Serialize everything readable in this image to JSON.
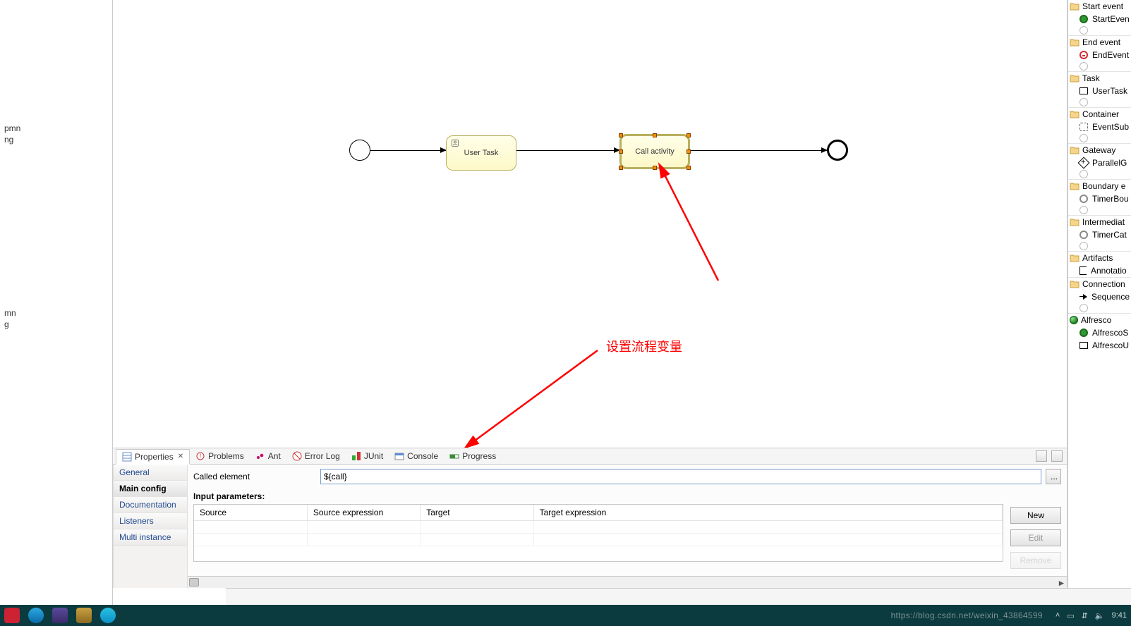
{
  "left_files": [
    {
      "name_top": "pmn",
      "name_bottom": "ng"
    },
    {
      "name_top": "mn",
      "name_bottom": "g"
    }
  ],
  "diagram": {
    "user_task_label": "User Task",
    "call_activity_label": "Call activity"
  },
  "annotation": {
    "text": "设置流程变量"
  },
  "tabs": [
    {
      "label": "Properties",
      "active": true,
      "closable": true
    },
    {
      "label": "Problems"
    },
    {
      "label": "Ant"
    },
    {
      "label": "Error Log"
    },
    {
      "label": "JUnit"
    },
    {
      "label": "Console"
    },
    {
      "label": "Progress"
    }
  ],
  "prop_sidebar": [
    {
      "label": "General"
    },
    {
      "label": "Main config",
      "active": true
    },
    {
      "label": "Documentation"
    },
    {
      "label": "Listeners"
    },
    {
      "label": "Multi instance"
    }
  ],
  "properties": {
    "called_element_label": "Called element",
    "called_element_value": "${call}",
    "ellipsis": "...",
    "input_params_label": "Input parameters:",
    "columns": {
      "source": "Source",
      "source_expr": "Source expression",
      "target": "Target",
      "target_expr": "Target expression"
    },
    "buttons": {
      "new": "New",
      "edit": "Edit",
      "remove": "Remove"
    }
  },
  "palette": {
    "categories": [
      {
        "label": "Start event",
        "items": [
          {
            "label": "StartEven",
            "icon": "green-fill"
          }
        ],
        "dim_below": true
      },
      {
        "label": "End event",
        "items": [
          {
            "label": "EndEvent",
            "icon": "red-ring"
          }
        ],
        "dim_below": true
      },
      {
        "label": "Task",
        "items": [
          {
            "label": "UserTask",
            "icon": "rect-box"
          }
        ],
        "dim_below": true
      },
      {
        "label": "Container",
        "items": [
          {
            "label": "EventSub",
            "icon": "dashed-box"
          }
        ],
        "dim_below": true
      },
      {
        "label": "Gateway",
        "items": [
          {
            "label": "ParallelG",
            "icon": "diamond plus"
          }
        ],
        "dim_below": true
      },
      {
        "label": "Boundary e",
        "items": [
          {
            "label": "TimerBou",
            "icon": "grey-ring"
          }
        ],
        "dim_below": true
      },
      {
        "label": "Intermediat",
        "items": [
          {
            "label": "TimerCat",
            "icon": "grey-ring"
          }
        ],
        "dim_below": true
      },
      {
        "label": "Artifacts",
        "items": [
          {
            "label": "Annotatio",
            "icon": "bracket-icon"
          }
        ]
      },
      {
        "label": "Connection",
        "items": [
          {
            "label": "Sequence",
            "icon": "arrow-icon"
          }
        ],
        "dim_below": true
      },
      {
        "label": "Alfresco",
        "items": [
          {
            "label": "AlfrescoS",
            "icon": "green-fill"
          },
          {
            "label": "AlfrescoU",
            "icon": "rect-box"
          }
        ],
        "alfresco": true
      }
    ]
  },
  "watermark": "https://blog.csdn.net/weixin_43864599",
  "taskbar": {
    "time": "9:41",
    "date": ""
  }
}
